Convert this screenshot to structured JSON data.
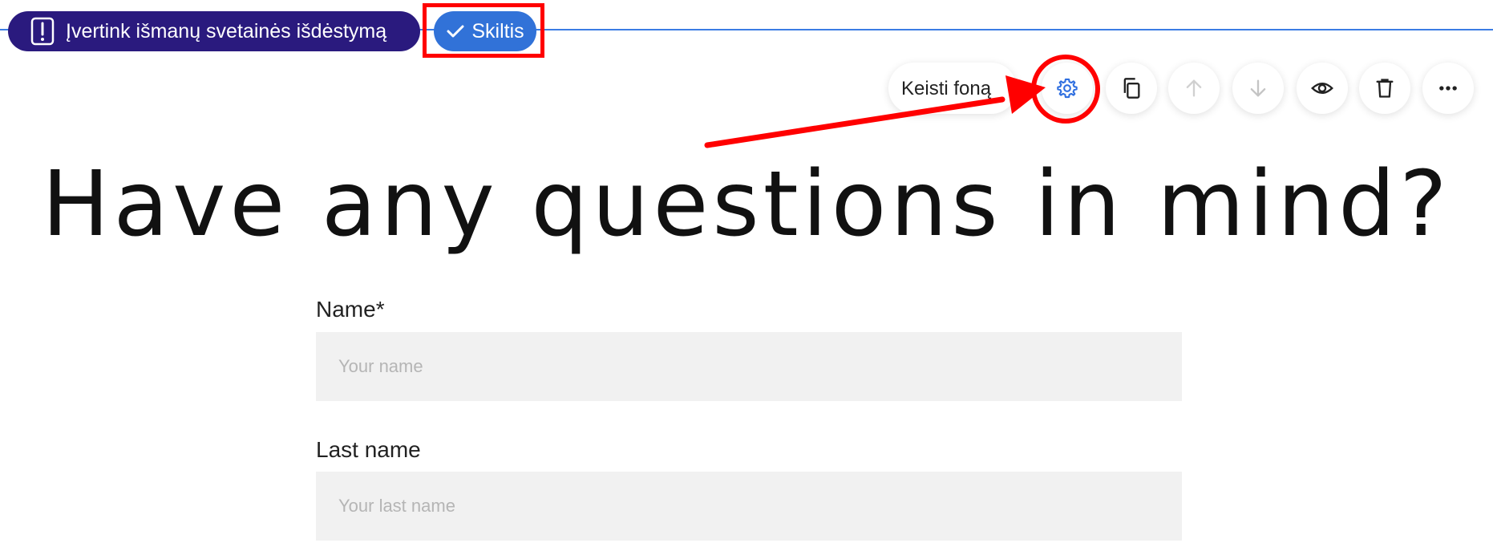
{
  "top_bar": {
    "ai_layout_label": "Įvertink išmanų svetainės išdėstymą",
    "section_label": "Skiltis"
  },
  "toolbar": {
    "change_background_label": "Keisti foną",
    "icons": [
      "gear-icon",
      "copy-icon",
      "arrow-up-icon",
      "arrow-down-icon",
      "eye-icon",
      "trash-icon",
      "more-icon"
    ]
  },
  "main": {
    "heading": "Have any questions in mind?",
    "form": {
      "name_label": "Name*",
      "name_placeholder": "Your name",
      "lastname_label": "Last name",
      "lastname_placeholder": "Your last name"
    }
  },
  "colors": {
    "ai_pill": "#2a1a7e",
    "section_pill": "#3172d8",
    "selection_line": "#3b7ce4",
    "annotation": "#ff0000",
    "field_bg": "#f1f1f1"
  }
}
